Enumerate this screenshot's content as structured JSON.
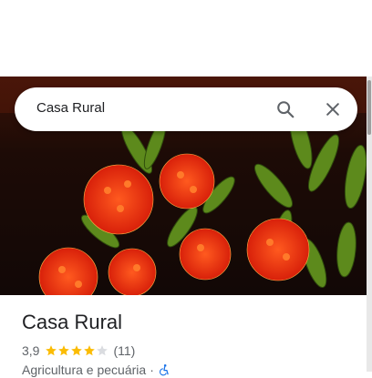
{
  "search": {
    "query": "Casa Rural",
    "search_icon": "search-icon",
    "close_icon": "close-icon"
  },
  "photo": {
    "subject": "red flowers with green leaves"
  },
  "place": {
    "name": "Casa Rural",
    "rating": "3,9",
    "stars_filled": 4,
    "stars_total": 5,
    "review_count": "(11)",
    "category": "Agricultura e pecuária",
    "separator": "·",
    "accessibility_icon": "wheelchair-icon"
  },
  "colors": {
    "star": "#fbbc04",
    "star_empty": "#dadce0",
    "accessibility": "#1a73e8"
  }
}
